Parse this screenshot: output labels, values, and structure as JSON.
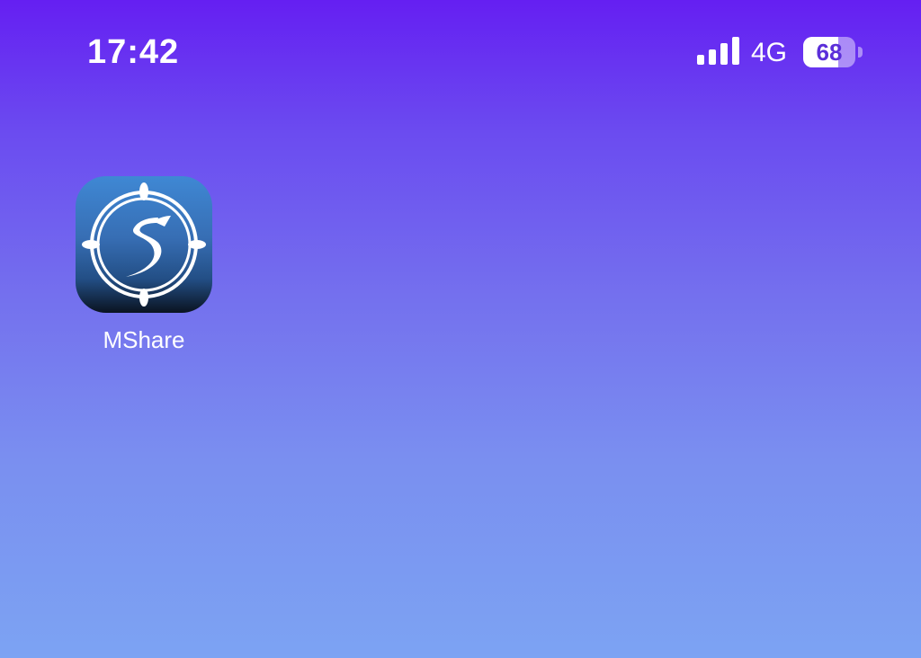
{
  "status_bar": {
    "time": "17:42",
    "network": "4G",
    "signal_icon": "cellular-signal-icon",
    "battery": {
      "icon": "battery-icon",
      "level_label": "68",
      "level_percent": 68
    }
  },
  "home_screen": {
    "apps": [
      {
        "label": "MShare",
        "icon": "mshare-app-icon"
      }
    ]
  },
  "colors": {
    "wallpaper_top": "#651ff2",
    "wallpaper_bottom": "#7ca3f3",
    "app_icon_top": "#3f88d4",
    "app_icon_bottom": "#0a1320"
  }
}
